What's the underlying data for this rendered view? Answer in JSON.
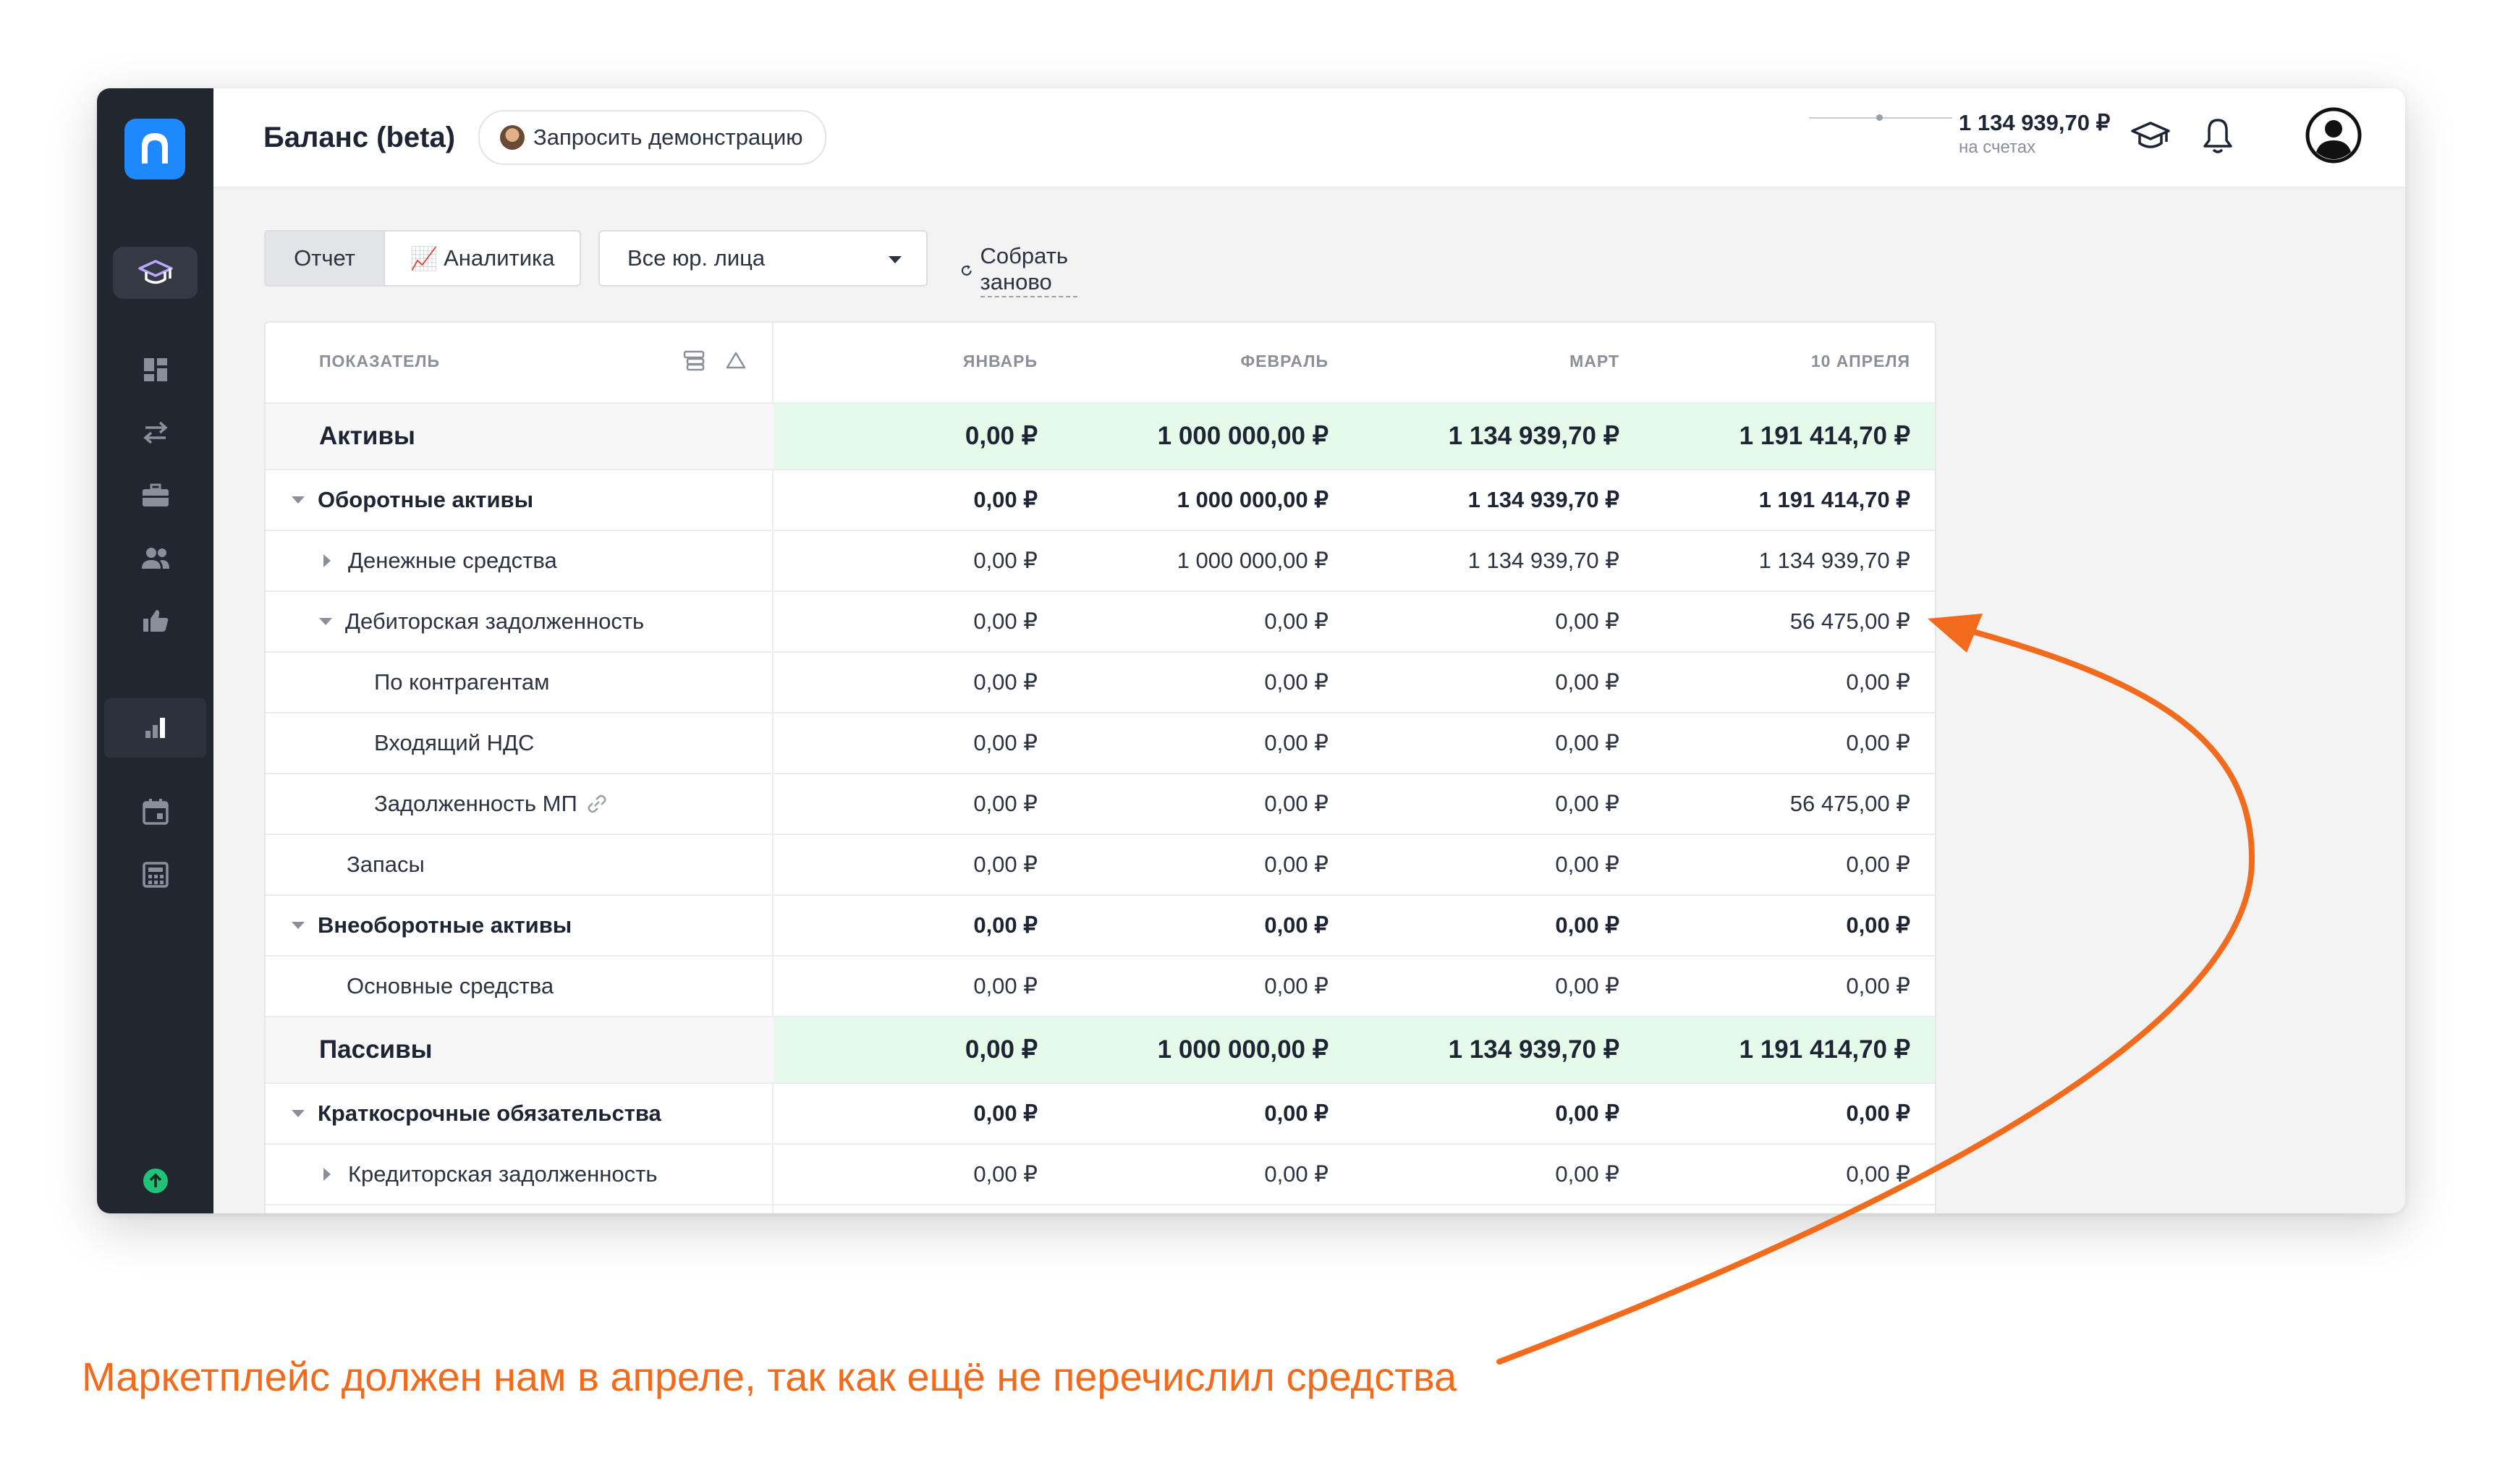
{
  "header": {
    "title": "Баланс (beta)",
    "demo_button": "Запросить демонстрацию",
    "balance": "1 134 939,70 ₽",
    "balance_caption": "на счетах"
  },
  "sidebar": {
    "items": [
      "education-icon",
      "dashboard-icon",
      "transfers-icon",
      "briefcase-icon",
      "users-icon",
      "like-icon",
      "chart-icon",
      "calendar-icon",
      "calculator-icon"
    ],
    "status": "upgrade-icon"
  },
  "toolbar": {
    "tab_report": "Отчет",
    "tab_analytics_icon": "📈",
    "tab_analytics": "Аналитика",
    "entity_select": "Все юр. лица",
    "rebuild": "Собрать заново"
  },
  "table": {
    "columns": [
      "ПОКАЗАТЕЛЬ",
      "ЯНВАРЬ",
      "ФЕВРАЛЬ",
      "МАРТ",
      "10 АПРЕЛЯ"
    ],
    "rows": [
      {
        "label": "Активы",
        "values": [
          "0,00 ₽",
          "1 000 000,00 ₽",
          "1 134 939,70 ₽",
          "1 191 414,70 ₽"
        ]
      },
      {
        "label": "Оборотные активы",
        "values": [
          "0,00 ₽",
          "1 000 000,00 ₽",
          "1 134 939,70 ₽",
          "1 191 414,70 ₽"
        ]
      },
      {
        "label": "Денежные средства",
        "values": [
          "0,00 ₽",
          "1 000 000,00 ₽",
          "1 134 939,70 ₽",
          "1 134 939,70 ₽"
        ]
      },
      {
        "label": "Дебиторская задолженность",
        "values": [
          "0,00 ₽",
          "0,00 ₽",
          "0,00 ₽",
          "56 475,00 ₽"
        ]
      },
      {
        "label": "По контрагентам",
        "values": [
          "0,00 ₽",
          "0,00 ₽",
          "0,00 ₽",
          "0,00 ₽"
        ]
      },
      {
        "label": "Входящий НДС",
        "values": [
          "0,00 ₽",
          "0,00 ₽",
          "0,00 ₽",
          "0,00 ₽"
        ]
      },
      {
        "label": "Задолженность МП",
        "values": [
          "0,00 ₽",
          "0,00 ₽",
          "0,00 ₽",
          "56 475,00 ₽"
        ]
      },
      {
        "label": "Запасы",
        "values": [
          "0,00 ₽",
          "0,00 ₽",
          "0,00 ₽",
          "0,00 ₽"
        ]
      },
      {
        "label": "Внеоборотные активы",
        "values": [
          "0,00 ₽",
          "0,00 ₽",
          "0,00 ₽",
          "0,00 ₽"
        ]
      },
      {
        "label": "Основные средства",
        "values": [
          "0,00 ₽",
          "0,00 ₽",
          "0,00 ₽",
          "0,00 ₽"
        ]
      },
      {
        "label": "Пассивы",
        "values": [
          "0,00 ₽",
          "1 000 000,00 ₽",
          "1 134 939,70 ₽",
          "1 191 414,70 ₽"
        ]
      },
      {
        "label": "Краткосрочные обязательства",
        "values": [
          "0,00 ₽",
          "0,00 ₽",
          "0,00 ₽",
          "0,00 ₽"
        ]
      },
      {
        "label": "Кредиторская задолженность",
        "values": [
          "0,00 ₽",
          "0,00 ₽",
          "0,00 ₽",
          "0,00 ₽"
        ]
      }
    ]
  },
  "annotation": "Маркетплейс должен нам в апреле, так как ещё не перечислил средства",
  "colors": {
    "sidebar": "#22262f",
    "accent": "#1e88ff",
    "section_highlight": "#e6faea",
    "annotation": "#f26a1b"
  }
}
